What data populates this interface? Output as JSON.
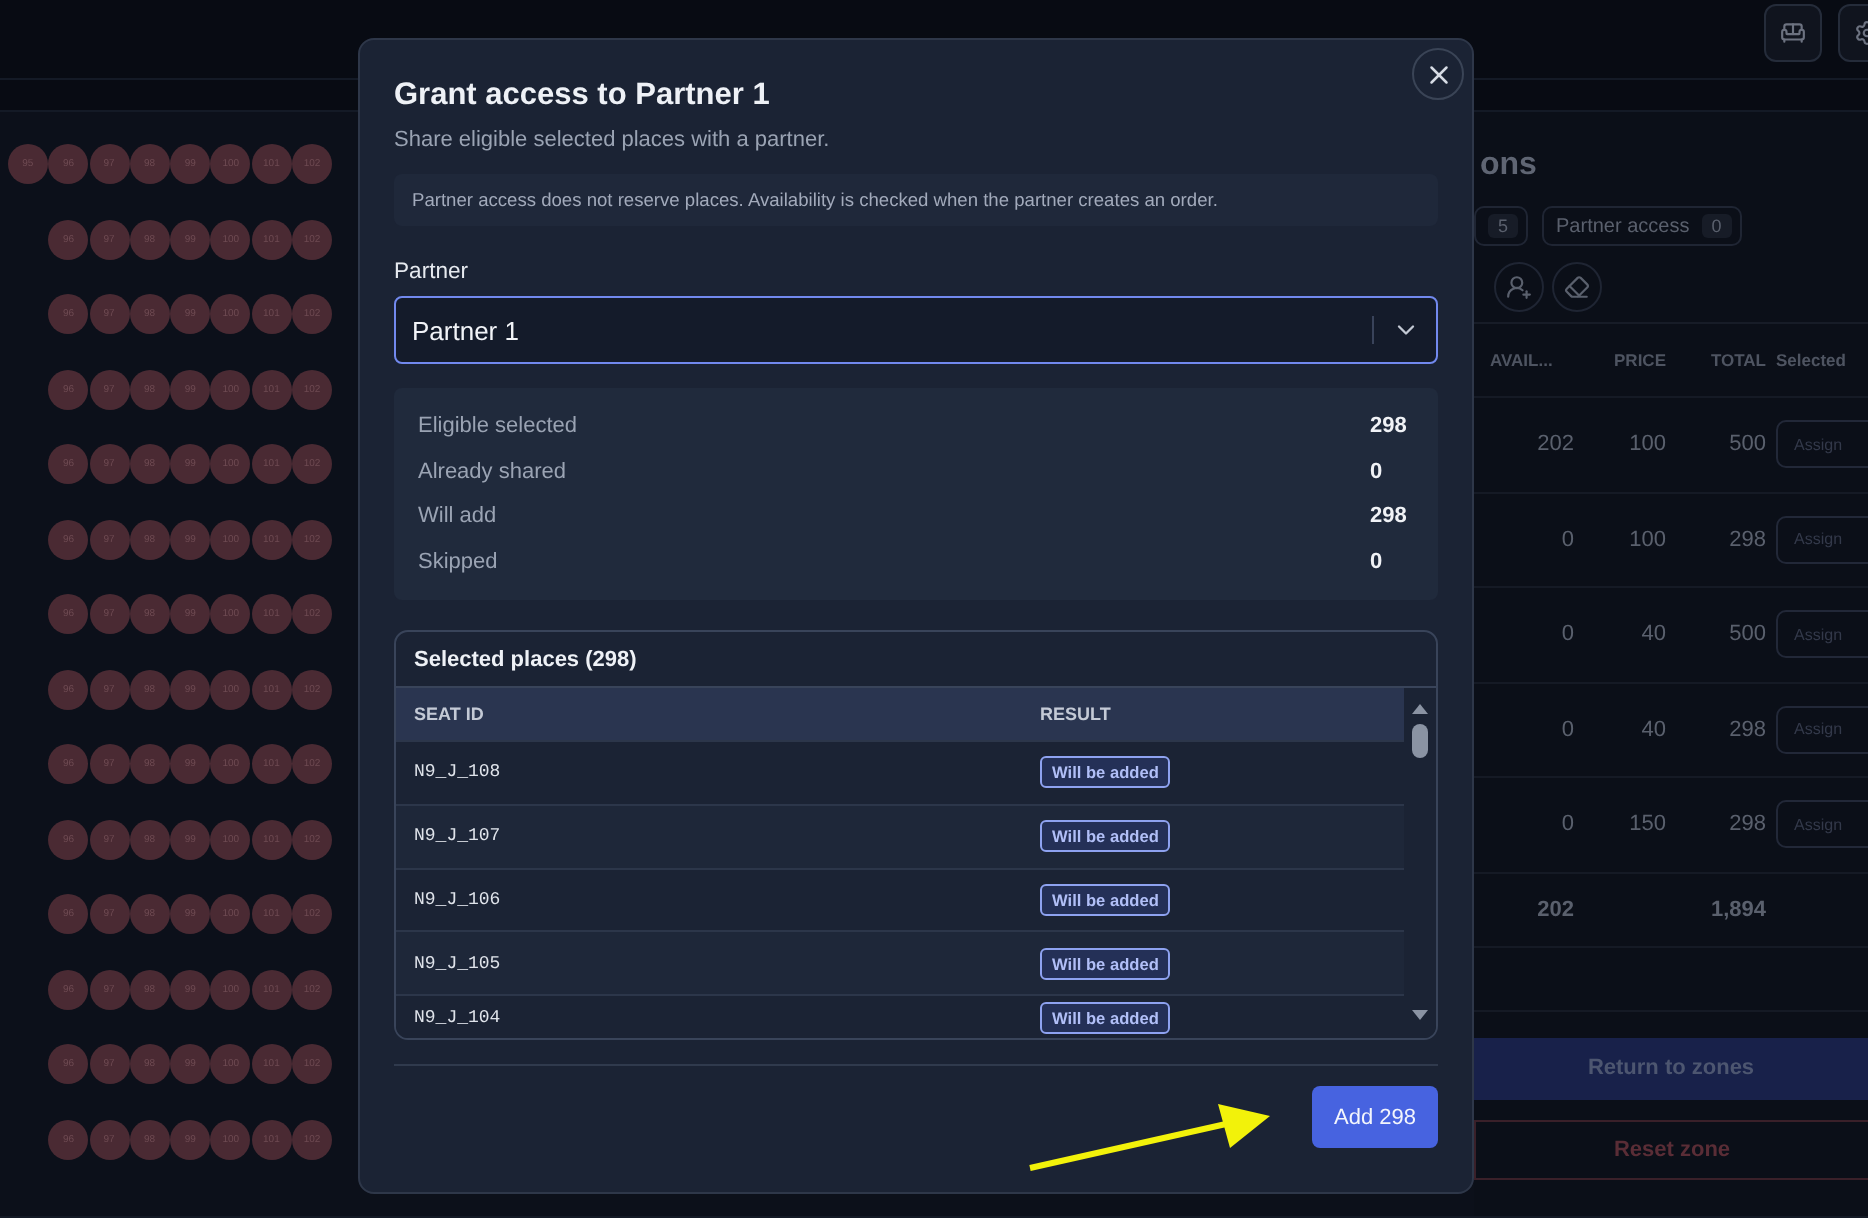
{
  "seat_map": {
    "rows": [
      {
        "seats": [
          "95",
          "96",
          "97",
          "98",
          "99",
          "100",
          "101",
          "102"
        ]
      },
      {
        "seats": [
          "96",
          "97",
          "98",
          "99",
          "100",
          "101",
          "102"
        ]
      },
      {
        "seats": [
          "96",
          "97",
          "98",
          "99",
          "100",
          "101",
          "102"
        ]
      },
      {
        "seats": [
          "96",
          "97",
          "98",
          "99",
          "100",
          "101",
          "102"
        ]
      },
      {
        "seats": [
          "96",
          "97",
          "98",
          "99",
          "100",
          "101",
          "102"
        ]
      },
      {
        "seats": [
          "96",
          "97",
          "98",
          "99",
          "100",
          "101",
          "102"
        ]
      },
      {
        "seats": [
          "96",
          "97",
          "98",
          "99",
          "100",
          "101",
          "102"
        ]
      },
      {
        "seats": [
          "96",
          "97",
          "98",
          "99",
          "100",
          "101",
          "102"
        ]
      },
      {
        "seats": [
          "96",
          "97",
          "98",
          "99",
          "100",
          "101",
          "102"
        ]
      },
      {
        "seats": [
          "96",
          "97",
          "98",
          "99",
          "100",
          "101",
          "102"
        ]
      },
      {
        "seats": [
          "96",
          "97",
          "98",
          "99",
          "100",
          "101",
          "102"
        ]
      },
      {
        "seats": [
          "96",
          "97",
          "98",
          "99",
          "100",
          "101",
          "102"
        ]
      },
      {
        "seats": [
          "96",
          "97",
          "98",
          "99",
          "100",
          "101",
          "102"
        ]
      },
      {
        "seats": [
          "96",
          "97",
          "98",
          "99",
          "100",
          "101",
          "102"
        ]
      }
    ]
  },
  "side_panel": {
    "title": "ons",
    "chips": [
      {
        "count": "5"
      },
      {
        "label": "Partner access",
        "count": "0"
      }
    ],
    "table": {
      "columns": [
        "AVAIL...",
        "PRICE",
        "TOTAL",
        "Selected"
      ],
      "rows": [
        {
          "available": "202",
          "price": "100",
          "total": "500",
          "action": "Assign"
        },
        {
          "available": "0",
          "price": "100",
          "total": "298",
          "action": "Assign"
        },
        {
          "available": "0",
          "price": "40",
          "total": "500",
          "action": "Assign"
        },
        {
          "available": "0",
          "price": "40",
          "total": "298",
          "action": "Assign"
        },
        {
          "available": "0",
          "price": "150",
          "total": "298",
          "action": "Assign"
        }
      ],
      "totals": {
        "available": "202",
        "total": "1,894"
      }
    },
    "buttons": [
      {
        "label": "Return to zones",
        "kind": "primary"
      },
      {
        "label": "Reset zone",
        "kind": "danger"
      }
    ]
  },
  "dialog": {
    "title": "Grant access to Partner 1",
    "subtitle": "Share eligible selected places with a partner.",
    "notice": "Partner access does not reserve places. Availability is checked when the partner creates an order.",
    "partner_field": {
      "label": "Partner",
      "value": "Partner 1"
    },
    "summary": [
      {
        "label": "Eligible selected",
        "value": "298"
      },
      {
        "label": "Already shared",
        "value": "0"
      },
      {
        "label": "Will add",
        "value": "298"
      },
      {
        "label": "Skipped",
        "value": "0"
      }
    ],
    "places": {
      "title": "Selected places (298)",
      "columns": [
        "SEAT ID",
        "RESULT"
      ],
      "rows": [
        {
          "seat_id": "N9_J_108",
          "result": "Will be added"
        },
        {
          "seat_id": "N9_J_107",
          "result": "Will be added"
        },
        {
          "seat_id": "N9_J_106",
          "result": "Will be added"
        },
        {
          "seat_id": "N9_J_105",
          "result": "Will be added"
        },
        {
          "seat_id": "N9_J_104",
          "result": "Will be added"
        }
      ]
    },
    "submit": "Add 298"
  }
}
